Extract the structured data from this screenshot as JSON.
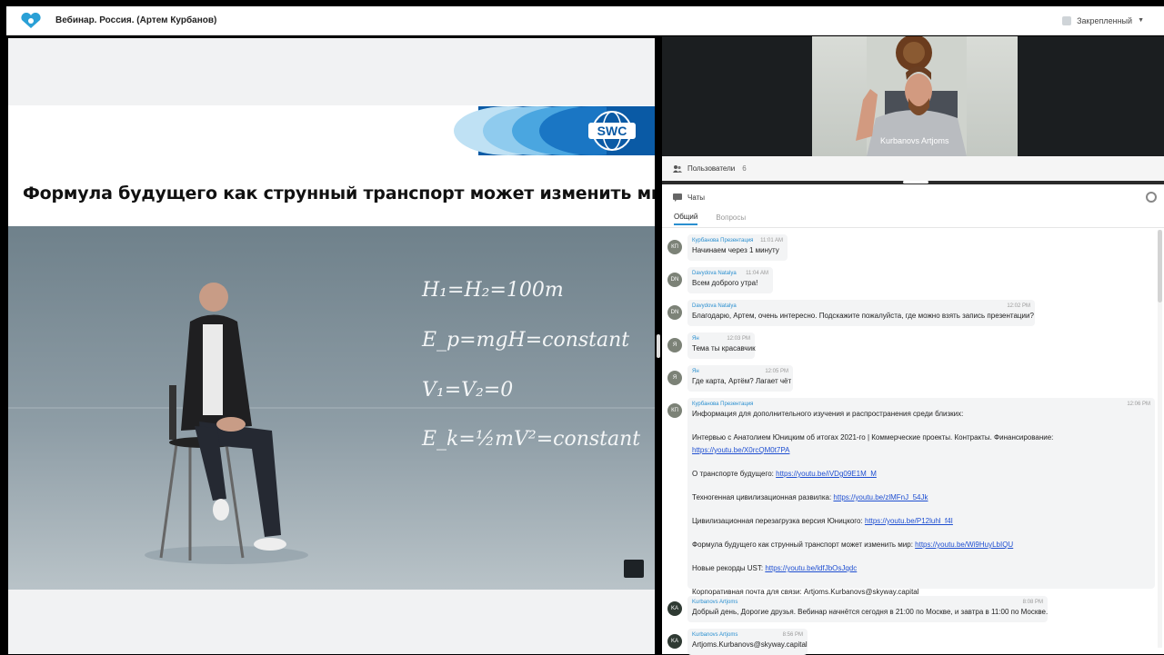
{
  "app": {
    "title": "Вебинар. Россия. (Артем Курбанов)",
    "pinned_label": "Закрепленный"
  },
  "slide": {
    "logo_text": "SWC",
    "title": "Формула будущего как струнный транспорт может изменить мир",
    "formulas": [
      "H₁=H₂=100m",
      "E_p=mgH=constant",
      "V₁=V₂=0",
      "E_k=½mV²=constant"
    ]
  },
  "camera": {
    "name": "Kurbanovs Artjoms"
  },
  "users": {
    "label": "Пользователи",
    "count": "6"
  },
  "chat": {
    "title": "Чаты",
    "tabs": [
      "Общий",
      "Вопросы"
    ],
    "messages": [
      {
        "initials": "КП",
        "author": "Курбанова Презентация",
        "time": "11:01 AM",
        "lines": [
          "Начинаем через 1 минуту"
        ]
      },
      {
        "initials": "DN",
        "author": "Davydova Natalya",
        "time": "11:04 AM",
        "lines": [
          "Всем доброго утра!"
        ]
      },
      {
        "initials": "DN",
        "author": "Davydova Natalya",
        "time": "12:02 PM",
        "lines": [
          "Благодарю, Артем, очень интересно. Подскажите пожалуйста, где можно взять запись презентации?"
        ]
      },
      {
        "initials": "Я",
        "author": "Ян",
        "time": "12:03 PM",
        "lines": [
          "Тема ты красавчик"
        ]
      },
      {
        "initials": "Я",
        "author": "Ян",
        "time": "12:05 PM",
        "lines": [
          "Где карта, Артём? Лагает чёт"
        ]
      },
      {
        "initials": "КП",
        "author": "Курбанова Презентация",
        "time": "12:06 PM",
        "intro": "Информация для дополнительного изучения и распространения среди близких:",
        "items": [
          {
            "text": "Интервью с Анатолием Юницким об итогах 2021-го | Коммерческие проекты. Контракты. Финансирование:",
            "link": "https://youtu.be/X0rcQM0t7PA",
            "newline": true
          },
          {
            "text": "О транспорте будущего:",
            "link": "https://youtu.be/iVDg09E1M_M"
          },
          {
            "text": "Техногенная цивилизационная развилка:",
            "link": "https://youtu.be/zlMFnJ_54Jk"
          },
          {
            "text": "Цивилизационная перезагрузка версия Юницкого:",
            "link": "https://youtu.be/P12luhl_f4I"
          },
          {
            "text": "Формула будущего как струнный транспорт может изменить мир:",
            "link": "https://youtu.be/Wi9HuyLbIQU"
          },
          {
            "text": "Новые рекорды UST:",
            "link": "https://youtu.be/ldfJbOsJqdc"
          },
          {
            "text": "Корпоративная почта для связи: Artjoms.Kurbanovs@skyway.capital",
            "link": ""
          }
        ]
      },
      {
        "initials": "KA",
        "author": "Kurbanovs Artjoms",
        "time": "8:08 PM",
        "lines": [
          "Добрый день, Дорогие друзья. Вебинар начнётся сегодня в 21:00 по Москве, и завтра в 11:00 по Москве."
        ]
      },
      {
        "initials": "KA",
        "author": "Kurbanovs Artjoms",
        "time": "8:56 PM",
        "lines": [
          "Artjoms.Kurbanovs@skyway.capital"
        ]
      }
    ]
  },
  "colors": {
    "accent": "#2a8fd0",
    "link": "#1f4fd1",
    "swc_blue": "#0a5aa5"
  }
}
